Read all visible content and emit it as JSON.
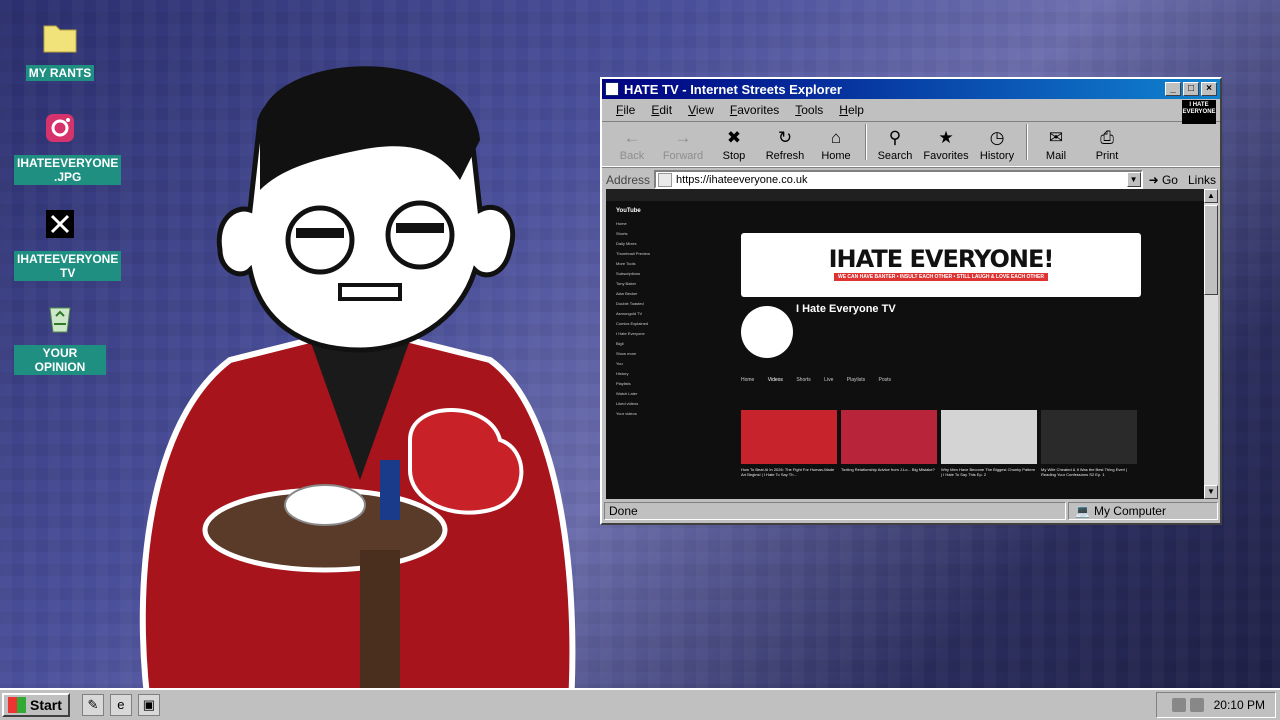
{
  "desktop": {
    "icons": [
      {
        "label": "MY RANTS",
        "icon": "folder-icon"
      },
      {
        "label": "IHATEEVERYONE .JPG",
        "icon": "instagram-icon"
      },
      {
        "label": "IHATEEVERYONE TV",
        "icon": "x-icon"
      },
      {
        "label": "YOUR OPINION",
        "icon": "recycle-bin-icon"
      }
    ]
  },
  "window": {
    "title": "HATE TV - Internet Streets Explorer",
    "menu": [
      "File",
      "Edit",
      "View",
      "Favorites",
      "Tools",
      "Help"
    ],
    "brand_logo": "I HATE EVERYONE",
    "toolbar": [
      {
        "label": "Back",
        "icon": "back-arrow-icon",
        "enabled": false
      },
      {
        "label": "Forward",
        "icon": "forward-arrow-icon",
        "enabled": false
      },
      {
        "label": "Stop",
        "icon": "stop-icon",
        "enabled": true
      },
      {
        "label": "Refresh",
        "icon": "refresh-icon",
        "enabled": true
      },
      {
        "label": "Home",
        "icon": "home-icon",
        "enabled": true
      },
      {
        "label": "Search",
        "icon": "search-icon",
        "enabled": true
      },
      {
        "label": "Favorites",
        "icon": "favorites-icon",
        "enabled": true
      },
      {
        "label": "History",
        "icon": "history-icon",
        "enabled": true
      },
      {
        "label": "Mail",
        "icon": "mail-icon",
        "enabled": true
      },
      {
        "label": "Print",
        "icon": "print-icon",
        "enabled": true
      }
    ],
    "address": {
      "label": "Address",
      "value": "https://ihateeveryone.co.uk",
      "go": "Go",
      "links": "Links"
    },
    "status": {
      "left": "Done",
      "right": "My Computer"
    },
    "page": {
      "site": "YouTube",
      "banner_title": "IHATE EVERYONE!",
      "banner_tagline": "WE CAN HAVE BANTER • INSULT EACH OTHER • STILL LAUGH & LOVE EACH OTHER",
      "channel_name": "I Hate Everyone TV",
      "tabs": [
        "Home",
        "Videos",
        "Shorts",
        "Live",
        "Playlists",
        "Posts"
      ],
      "sidebar": [
        "Home",
        "Shorts",
        "Daily Mixes",
        "Thumbnail Preview",
        "More Tools",
        "Subscriptions",
        "Tony Baker",
        "Alan Becker",
        "Double Toasted",
        "Asmongold TV",
        "Comics Explained",
        "I Hate Everyone",
        "Bigil",
        "Show more",
        "You",
        "History",
        "Playlists",
        "Watch Later",
        "Liked videos",
        "Your videos"
      ],
      "videos": [
        {
          "title": "How To Beat AI In 2026: The Fight For Human-Made Art Begins! | I Hate To Say Th..."
        },
        {
          "title": "Toxting Relationship Advice from J.Lo... Big Mistake?"
        },
        {
          "title": "Why Men Have Become The Biggest Chunky Pattern | I Hate To Say This Ep. 2"
        },
        {
          "title": "My Wife Cheated & It Was the Best Thing Ever! | Reading Your Confessions S2 Ep. 1"
        }
      ]
    }
  },
  "taskbar": {
    "start_label": "Start",
    "quick_launch": [
      "notepad-icon",
      "internet-explorer-icon",
      "desktop-icon"
    ],
    "clock": "20:10 PM"
  }
}
